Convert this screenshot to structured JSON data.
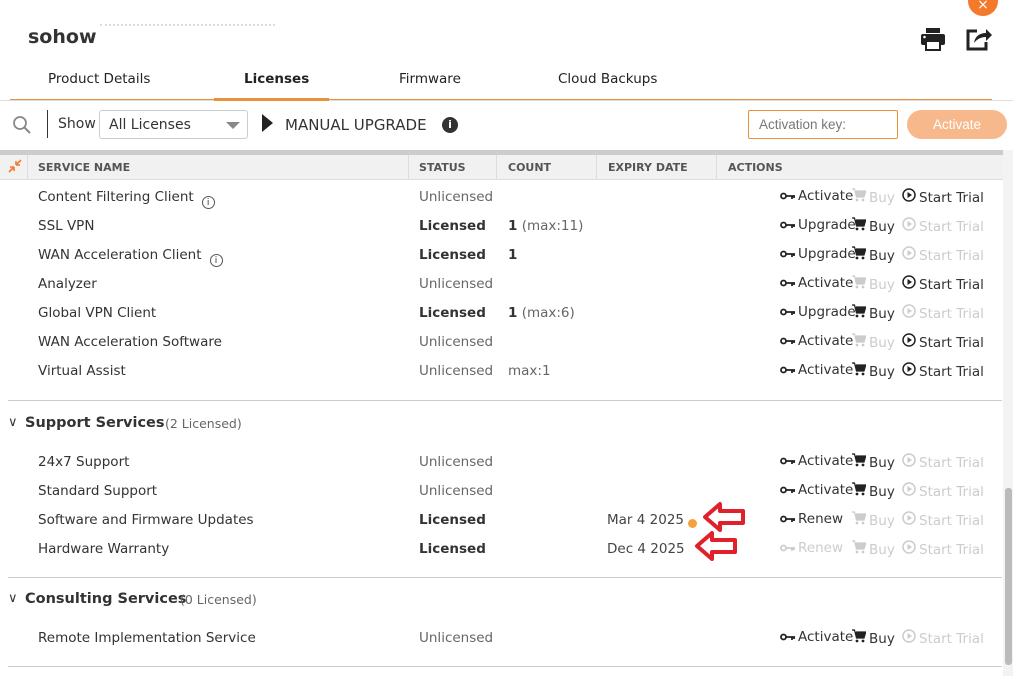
{
  "header": {
    "title": "sohow",
    "close_icon": "×"
  },
  "tabs": [
    {
      "label": "Product Details"
    },
    {
      "label": "Licenses",
      "active": true
    },
    {
      "label": "Firmware"
    },
    {
      "label": "Cloud Backups"
    }
  ],
  "toolbar": {
    "show_label": "Show",
    "filter_value": "All Licenses",
    "manual_upgrade": "MANUAL UPGRADE",
    "activation_placeholder": "Activation key:",
    "activate_button": "Activate"
  },
  "columns": [
    "SERVICE NAME",
    "STATUS",
    "COUNT",
    "EXPIRY DATE",
    "ACTIONS"
  ],
  "colors": {
    "accent": "#e8923e",
    "warning_dot": "#f5a03c",
    "annotation_arrow": "#e0202a"
  },
  "groups": [
    {
      "label": null,
      "rows": [
        {
          "name": "Content Filtering Client",
          "info": true,
          "status": "Unlicensed",
          "actions": [
            {
              "label": "Activate",
              "icon": "key-icon",
              "enabled": true
            },
            {
              "label": "Buy",
              "icon": "cart-icon",
              "enabled": false
            },
            {
              "label": "Start Trial",
              "icon": "play-circle-icon",
              "enabled": true
            }
          ]
        },
        {
          "name": "SSL VPN",
          "status": "Licensed",
          "count": "1",
          "count_extra": "(max:11)",
          "actions": [
            {
              "label": "Upgrade",
              "icon": "key-icon",
              "enabled": true
            },
            {
              "label": "Buy",
              "icon": "cart-icon",
              "enabled": true
            },
            {
              "label": "Start Trial",
              "icon": "play-circle-icon",
              "enabled": false
            }
          ]
        },
        {
          "name": "WAN Acceleration Client",
          "info": true,
          "status": "Licensed",
          "count": "1",
          "actions": [
            {
              "label": "Upgrade",
              "icon": "key-icon",
              "enabled": true
            },
            {
              "label": "Buy",
              "icon": "cart-icon",
              "enabled": true
            },
            {
              "label": "Start Trial",
              "icon": "play-circle-icon",
              "enabled": false
            }
          ]
        },
        {
          "name": "Analyzer",
          "status": "Unlicensed",
          "actions": [
            {
              "label": "Activate",
              "icon": "key-icon",
              "enabled": true
            },
            {
              "label": "Buy",
              "icon": "cart-icon",
              "enabled": false
            },
            {
              "label": "Start Trial",
              "icon": "play-circle-icon",
              "enabled": true
            }
          ]
        },
        {
          "name": "Global VPN Client",
          "status": "Licensed",
          "count": "1",
          "count_extra": "(max:6)",
          "actions": [
            {
              "label": "Upgrade",
              "icon": "key-icon",
              "enabled": true
            },
            {
              "label": "Buy",
              "icon": "cart-icon",
              "enabled": true
            },
            {
              "label": "Start Trial",
              "icon": "play-circle-icon",
              "enabled": false
            }
          ]
        },
        {
          "name": "WAN Acceleration Software",
          "status": "Unlicensed",
          "actions": [
            {
              "label": "Activate",
              "icon": "key-icon",
              "enabled": true
            },
            {
              "label": "Buy",
              "icon": "cart-icon",
              "enabled": false
            },
            {
              "label": "Start Trial",
              "icon": "play-circle-icon",
              "enabled": true
            }
          ]
        },
        {
          "name": "Virtual Assist",
          "status": "Unlicensed",
          "count_extra": "max:1",
          "actions": [
            {
              "label": "Activate",
              "icon": "key-icon",
              "enabled": true
            },
            {
              "label": "Buy",
              "icon": "cart-icon",
              "enabled": true
            },
            {
              "label": "Start Trial",
              "icon": "play-circle-icon",
              "enabled": true
            }
          ]
        }
      ]
    },
    {
      "label": "Support Services",
      "count": "(2 Licensed)",
      "rows": [
        {
          "name": "24x7 Support",
          "status": "Unlicensed",
          "actions": [
            {
              "label": "Activate",
              "icon": "key-icon",
              "enabled": true
            },
            {
              "label": "Buy",
              "icon": "cart-icon",
              "enabled": true
            },
            {
              "label": "Start Trial",
              "icon": "play-circle-icon",
              "enabled": false
            }
          ]
        },
        {
          "name": "Standard Support",
          "status": "Unlicensed",
          "actions": [
            {
              "label": "Activate",
              "icon": "key-icon",
              "enabled": true
            },
            {
              "label": "Buy",
              "icon": "cart-icon",
              "enabled": true
            },
            {
              "label": "Start Trial",
              "icon": "play-circle-icon",
              "enabled": false
            }
          ]
        },
        {
          "name": "Software and Firmware Updates",
          "status": "Licensed",
          "expiry": "Mar 4 2025",
          "expiry_warning": true,
          "arrow": true,
          "actions": [
            {
              "label": "Renew",
              "icon": "key-icon",
              "enabled": true
            },
            {
              "label": "Buy",
              "icon": "cart-icon",
              "enabled": false
            },
            {
              "label": "Start Trial",
              "icon": "play-circle-icon",
              "enabled": false
            }
          ]
        },
        {
          "name": "Hardware Warranty",
          "status": "Licensed",
          "expiry": "Dec 4 2025",
          "arrow": true,
          "actions": [
            {
              "label": "Renew",
              "icon": "key-icon",
              "enabled": false
            },
            {
              "label": "Buy",
              "icon": "cart-icon",
              "enabled": false
            },
            {
              "label": "Start Trial",
              "icon": "play-circle-icon",
              "enabled": false
            }
          ]
        }
      ]
    },
    {
      "label": "Consulting Services",
      "count": "(0 Licensed)",
      "rows": [
        {
          "name": "Remote Implementation Service",
          "status": "Unlicensed",
          "actions": [
            {
              "label": "Activate",
              "icon": "key-icon",
              "enabled": true
            },
            {
              "label": "Buy",
              "icon": "cart-icon",
              "enabled": true
            },
            {
              "label": "Start Trial",
              "icon": "play-circle-icon",
              "enabled": false
            }
          ]
        }
      ]
    }
  ]
}
